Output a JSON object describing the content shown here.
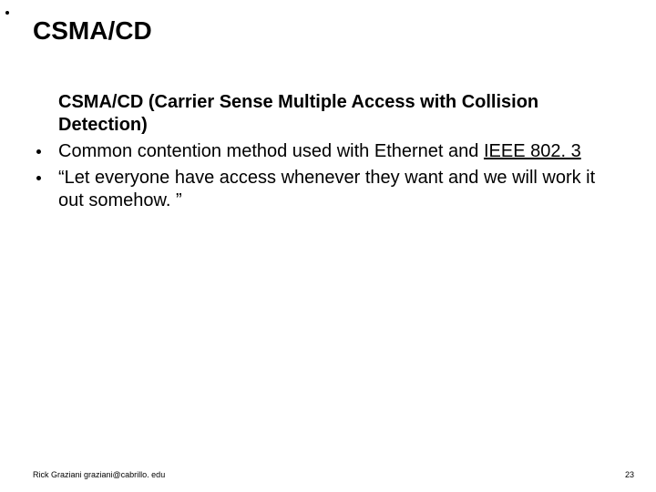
{
  "title": "CSMA/CD",
  "intro": "CSMA/CD (Carrier Sense Multiple Access with Collision Detection)",
  "bullets": [
    {
      "pre": "Common contention method used with Ethernet and ",
      "underlined": "IEEE 802. 3",
      "post": ""
    },
    {
      "pre": "“Let everyone have access whenever they want and we will work it out somehow. ”",
      "underlined": "",
      "post": ""
    }
  ],
  "footer": {
    "author": "Rick Graziani  graziani@cabrillo. edu",
    "page": "23"
  }
}
